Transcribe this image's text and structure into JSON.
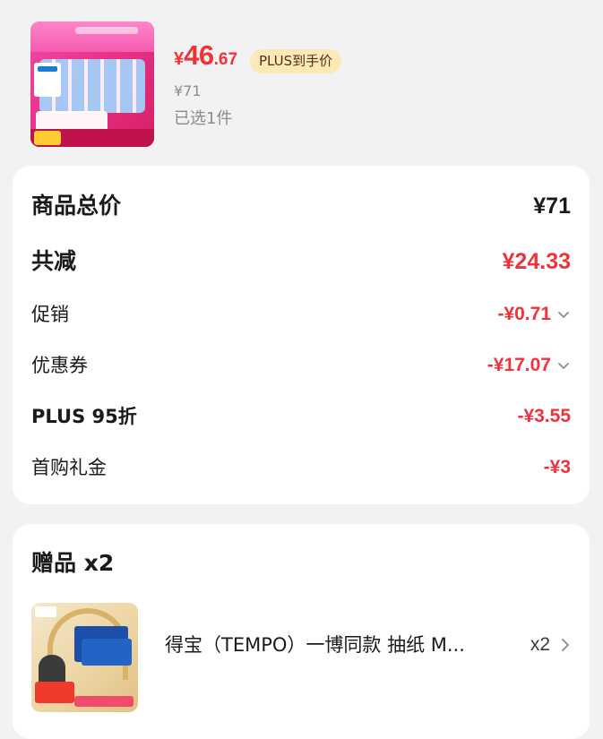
{
  "product": {
    "price_symbol": "¥",
    "price_integer": "46",
    "price_decimal": ".67",
    "plus_badge": "PLUS到手价",
    "original_price": "¥71",
    "selected_count": "已选1件"
  },
  "summary": {
    "total_label": "商品总价",
    "total_value": "¥71",
    "reduction_label": "共减",
    "reduction_value": "¥24.33",
    "promotion_label": "促销",
    "promotion_value": "-¥0.71",
    "coupon_label": "优惠券",
    "coupon_value": "-¥17.07",
    "plus_label": "PLUS 95折",
    "plus_value": "-¥3.55",
    "first_buy_label": "首购礼金",
    "first_buy_value": "-¥3"
  },
  "gifts": {
    "title": "赠品 x2",
    "item_name": "得宝（TEMPO）一博同款 抽纸 M...",
    "item_qty": "x2"
  },
  "colors": {
    "price_red": "#f0323b",
    "plus_badge_bg": "#fde9b6",
    "card_bg": "#ffffff",
    "page_bg": "#f2f2f2"
  },
  "icons": {
    "promotion_expand": "chevron-down-icon",
    "coupon_expand": "chevron-down-icon",
    "gift_arrow": "chevron-right-icon"
  }
}
